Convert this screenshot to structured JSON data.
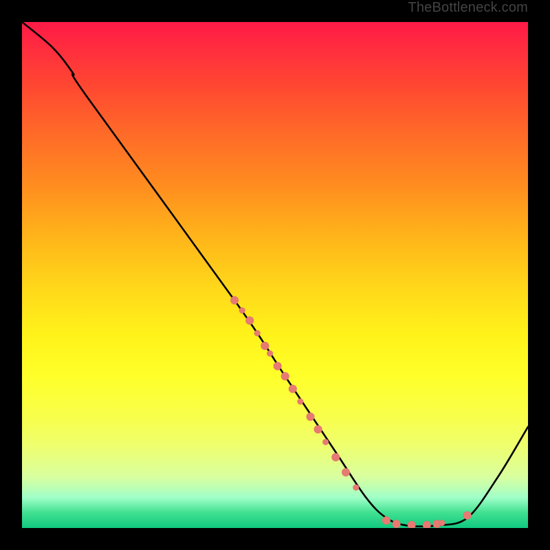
{
  "watermark": "TheBottleneck.com",
  "chart_data": {
    "type": "line",
    "title": "",
    "xlabel": "",
    "ylabel": "",
    "xlim": [
      0,
      100
    ],
    "ylim": [
      0,
      100
    ],
    "curve": [
      {
        "x": 0,
        "y": 100
      },
      {
        "x": 6,
        "y": 95
      },
      {
        "x": 10,
        "y": 90
      },
      {
        "x": 13,
        "y": 85
      },
      {
        "x": 42,
        "y": 45
      },
      {
        "x": 52,
        "y": 30
      },
      {
        "x": 62,
        "y": 15
      },
      {
        "x": 68,
        "y": 6
      },
      {
        "x": 72,
        "y": 2
      },
      {
        "x": 76,
        "y": 0.5
      },
      {
        "x": 82,
        "y": 0.5
      },
      {
        "x": 88,
        "y": 2
      },
      {
        "x": 94,
        "y": 10
      },
      {
        "x": 100,
        "y": 20
      }
    ],
    "markers_on_slope": [
      {
        "x": 42,
        "y": 45,
        "size": "small"
      },
      {
        "x": 43.5,
        "y": 43,
        "size": "tiny"
      },
      {
        "x": 45,
        "y": 41,
        "size": "small"
      },
      {
        "x": 46.5,
        "y": 38.5,
        "size": "tiny"
      },
      {
        "x": 48,
        "y": 36,
        "size": "small"
      },
      {
        "x": 49,
        "y": 34.5,
        "size": "tiny"
      },
      {
        "x": 50.5,
        "y": 32,
        "size": "small"
      },
      {
        "x": 52,
        "y": 30,
        "size": "small"
      },
      {
        "x": 53.5,
        "y": 27.5,
        "size": "small"
      },
      {
        "x": 55,
        "y": 25,
        "size": "tiny"
      },
      {
        "x": 57,
        "y": 22,
        "size": "small"
      },
      {
        "x": 58.5,
        "y": 19.5,
        "size": "small"
      },
      {
        "x": 60,
        "y": 17,
        "size": "tiny"
      },
      {
        "x": 62,
        "y": 14,
        "size": "small"
      },
      {
        "x": 64,
        "y": 11,
        "size": "small"
      },
      {
        "x": 66,
        "y": 8,
        "size": "tiny"
      }
    ],
    "markers_at_valley": [
      {
        "x": 72,
        "y": 1.5,
        "size": "small"
      },
      {
        "x": 74,
        "y": 0.8,
        "size": "small"
      },
      {
        "x": 77,
        "y": 0.6,
        "size": "small"
      },
      {
        "x": 80,
        "y": 0.6,
        "size": "small"
      },
      {
        "x": 82,
        "y": 0.8,
        "size": "small"
      },
      {
        "x": 83,
        "y": 1.0,
        "size": "tiny"
      },
      {
        "x": 88,
        "y": 2.5,
        "size": "small"
      }
    ],
    "colors": {
      "curve": "#000000",
      "markers": "#e77a72",
      "gradient_top": "#ff1a47",
      "gradient_bottom": "#10c880"
    }
  }
}
